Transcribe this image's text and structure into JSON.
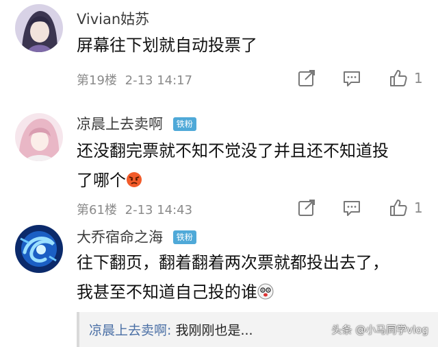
{
  "comments": [
    {
      "username": "Vivian姑苏",
      "badge": "",
      "content_lines": [
        "屏幕往下划就自动投票了"
      ],
      "floor": "第19楼",
      "time": "2-13 14:17",
      "likes": "1",
      "avatar_icon": "avatar-anime-purple-hair"
    },
    {
      "username": "凉晨上去卖啊",
      "badge": "铁粉",
      "content_lines": [
        "还没翻完票就不知不觉没了并且还不知道投",
        "了哪个"
      ],
      "emoji": "angry-face-emoji",
      "floor": "第61楼",
      "time": "2-13 14:43",
      "likes": "1",
      "avatar_icon": "avatar-anime-pink-hair"
    },
    {
      "username": "大乔宿命之海",
      "badge": "铁粉",
      "content_lines": [
        "往下翻页，翻着翻着两次票就都投出去了，",
        "我甚至不知道自己投的谁"
      ],
      "emoji": "dizzy-face-emoji",
      "avatar_icon": "avatar-blue-swirl"
    }
  ],
  "reply": {
    "author": "凉晨上去卖啊:",
    "text": " 我刚刚也是..."
  },
  "watermark": "头条 @小马同学vlog",
  "colors": {
    "badge": "#4fa9d8",
    "reply_author": "#4a6fa5",
    "meta_gray": "#8a8a8a"
  },
  "icons": [
    "share-icon",
    "comment-icon",
    "thumbs-up-icon"
  ]
}
